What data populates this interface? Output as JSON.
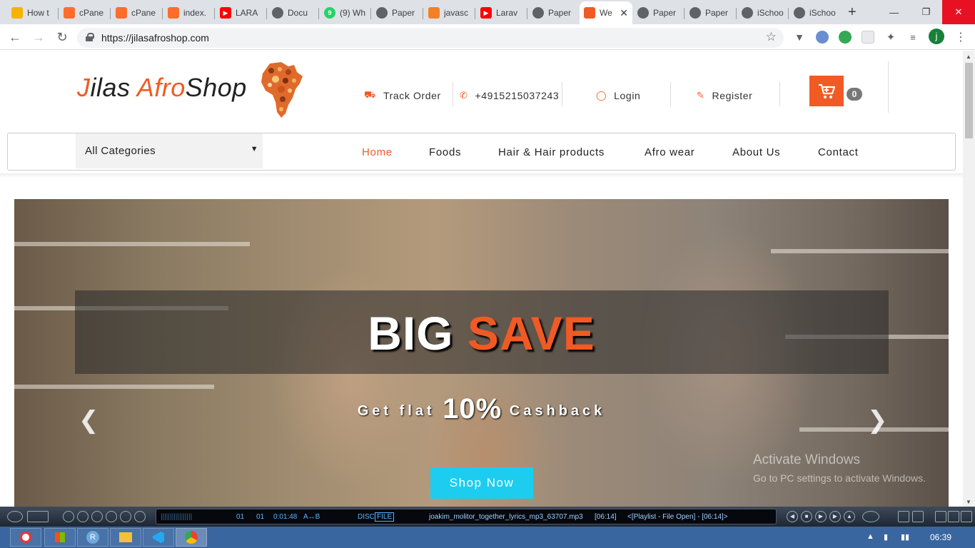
{
  "browser": {
    "tabs": [
      {
        "label": "How t",
        "icon": "folder-icon",
        "color": "#f5b400"
      },
      {
        "label": "cPane",
        "icon": "cpanel-icon",
        "color": "#ff6c2c"
      },
      {
        "label": "cPane",
        "icon": "cpanel-icon",
        "color": "#ff6c2c"
      },
      {
        "label": "index.",
        "icon": "cpanel-icon",
        "color": "#ff6c2c"
      },
      {
        "label": "LARA",
        "icon": "youtube-icon",
        "color": "#ff0000"
      },
      {
        "label": "Docu",
        "icon": "globe-icon",
        "color": "#5f6368"
      },
      {
        "label": "(9) Wh",
        "icon": "whatsapp-icon",
        "color": "#25d366"
      },
      {
        "label": "Paper",
        "icon": "globe-icon",
        "color": "#5f6368"
      },
      {
        "label": "javasc",
        "icon": "stackoverflow-icon",
        "color": "#f48024"
      },
      {
        "label": "Larav",
        "icon": "youtube-icon",
        "color": "#ff0000"
      },
      {
        "label": "Paper",
        "icon": "globe-icon",
        "color": "#5f6368"
      },
      {
        "label": "We",
        "icon": "africa-icon",
        "color": "#f15a24"
      },
      {
        "label": "Paper",
        "icon": "globe-icon",
        "color": "#5f6368"
      },
      {
        "label": "Paper",
        "icon": "globe-icon",
        "color": "#5f6368"
      },
      {
        "label": "iSchoo",
        "icon": "globe-icon",
        "color": "#5f6368"
      },
      {
        "label": "iSchoo",
        "icon": "globe-icon",
        "color": "#5f6368"
      }
    ],
    "url": "https://jilasafroshop.com",
    "profile_initial": "j"
  },
  "site": {
    "logo": {
      "j": "J",
      "ilas": "ilas ",
      "afro": "Afro",
      "shop": "Shop"
    },
    "header": {
      "track_order": "Track Order",
      "phone": "+4915215037243",
      "login": "Login",
      "register": "Register",
      "cart_count": "0"
    },
    "category_select": "All Categories",
    "nav": [
      "Home",
      "Foods",
      "Hair & Hair products",
      "Afro wear",
      "About Us",
      "Contact"
    ],
    "hero": {
      "big": "BIG",
      "save": "SAVE",
      "flat_pre": "Get flat",
      "flat_pct": "10%",
      "flat_post": "Cashback",
      "cta": "Shop Now"
    },
    "watermark": {
      "line1": "Activate Windows",
      "line2": "Go to PC settings to activate Windows."
    }
  },
  "player": {
    "track": "01",
    "index": "01",
    "time": "0:01:48",
    "ab": "A↔B",
    "disc": "DISC",
    "file": "FILE",
    "title": "joakim_molitor_together_lyrics_mp3_63707.mp3",
    "duration": "[06:14]",
    "playlist": "<[Playlist - File Open] - [06:14]>"
  },
  "taskbar": {
    "clock": "06:39"
  },
  "colors": {
    "accent": "#f15a24",
    "cta": "#1ccdf0",
    "taskbar": "#3a66a0"
  }
}
